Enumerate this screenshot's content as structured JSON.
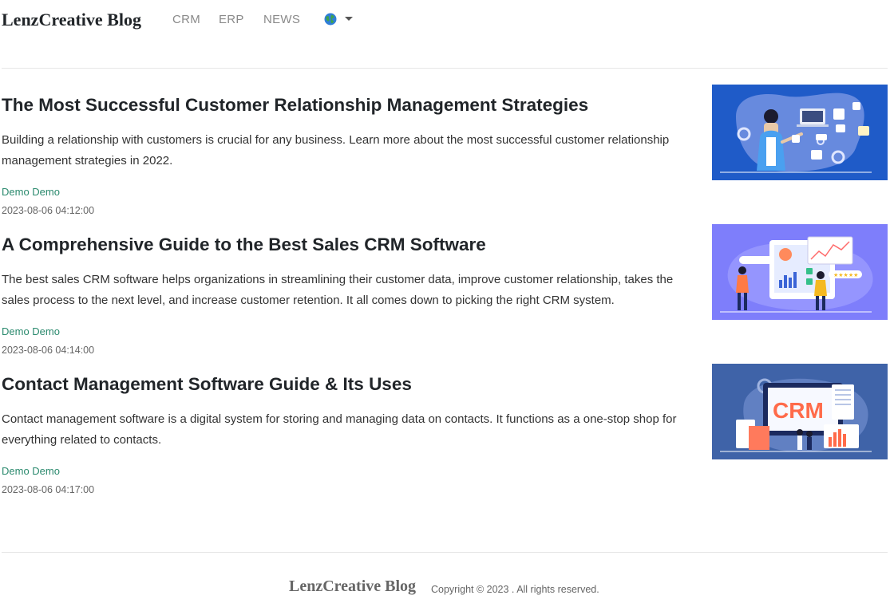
{
  "nav": {
    "brand": "LenzCreative Blog",
    "links": [
      "CRM",
      "ERP",
      "NEWS"
    ],
    "language_icon": "globe-icon"
  },
  "posts": [
    {
      "title": "The Most Successful Customer Relationship Management Strategies",
      "excerpt": "Building a relationship with customers is crucial for any business. Learn more about the most successful customer relationship management strategies in 2022.",
      "author": "Demo Demo",
      "date": "2023-08-06 04:12:00",
      "thumb_bg": "#1f5bc8"
    },
    {
      "title": "A Comprehensive Guide to the Best Sales CRM Software",
      "excerpt": "The best sales CRM software helps organizations in streamlining their customer data, improve customer relationship, takes the sales process to the next level, and increase customer retention. It all comes down to picking the right CRM system.",
      "author": "Demo Demo",
      "date": "2023-08-06 04:14:00",
      "thumb_bg": "#7e7efb"
    },
    {
      "title": "Contact Management Software Guide & Its Uses",
      "excerpt": "Contact management software is a digital system for storing and managing data on contacts. It functions as a one-stop shop for everything related to contacts.",
      "author": "Demo Demo",
      "date": "2023-08-06 04:17:00",
      "thumb_bg": "#3f63a8",
      "thumb_label": "CRM"
    }
  ],
  "footer": {
    "brand": "LenzCreative Blog",
    "copyright": "Copyright © 2023 . All rights reserved."
  }
}
